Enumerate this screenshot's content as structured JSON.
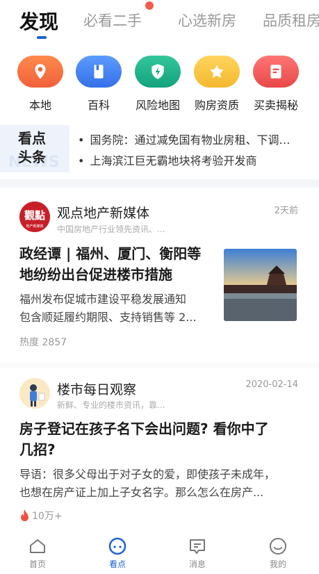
{
  "top_tabs": [
    {
      "label": "发现",
      "active": true
    },
    {
      "label": "必看二手",
      "has_dot": true
    },
    {
      "label": "心选新房"
    },
    {
      "label": "品质租房"
    }
  ],
  "entries": [
    {
      "label": "本地",
      "icon": "location-pin-icon",
      "color": "#f5713d"
    },
    {
      "label": "百科",
      "icon": "book-icon",
      "color": "#3f82f0"
    },
    {
      "label": "风险地图",
      "icon": "shield-icon",
      "color": "#1fb089"
    },
    {
      "label": "购房资质",
      "icon": "star-icon",
      "color": "#f7c244"
    },
    {
      "label": "买卖揭秘",
      "icon": "document-icon",
      "color": "#ef5a5a"
    }
  ],
  "headlines": {
    "title": "看点头条",
    "title_line1": "看点",
    "title_line2": "头条",
    "deco_text": "NEWS",
    "items": [
      "国务院：通过减免国有物业房租、下调担保费率等措施",
      "上海滨江巨无霸地块将考验开发商"
    ]
  },
  "feed": [
    {
      "source": "观点地产新媒体",
      "source_desc": "中国房地产行业领先资讯、...",
      "time": "2天前",
      "title_line1": "政经谭 | 福州、厦门、衡阳等",
      "title_line2": "地纷纷出台促进楼市措施",
      "summary_line1": "福州发布促城市建设平稳发展通知",
      "summary_line2": "包含顺延履约期限、支持销售等 2...",
      "meta": "热度 2857",
      "avatar_text": "觀點",
      "avatar_sub": "地产新媒体"
    },
    {
      "source": "楼市每日观察",
      "source_desc": "新鲜、专业的楼市资讯，靠...",
      "time": "2020-02-14",
      "title_line1": "房子登记在孩子名下会出问题? 看你中了",
      "title_line2": "几招?",
      "summary_line1": "导语：很多父母出于对子女的爱，即使孩子未成年，",
      "summary_line2": "也想在房产证上加上子女名字。那么怎么在房产...",
      "meta": "10万+"
    }
  ],
  "bottom_nav": [
    {
      "label": "首页",
      "icon": "home-icon"
    },
    {
      "label": "看点",
      "icon": "discover-icon",
      "active": true
    },
    {
      "label": "消息",
      "icon": "message-icon"
    },
    {
      "label": "我的",
      "icon": "profile-icon"
    }
  ],
  "colors": {
    "accent": "#1e5fd6",
    "dot": "#f25b4a",
    "fire": "#f04e3e"
  }
}
